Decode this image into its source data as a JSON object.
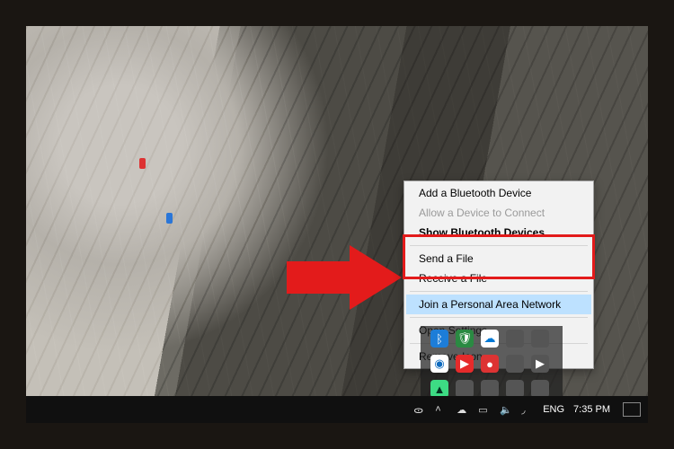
{
  "menu": {
    "add": "Add a Bluetooth Device",
    "allow": "Allow a Device to Connect",
    "show": "Show Bluetooth Devices",
    "send": "Send a File",
    "receive": "Receive a File",
    "pan": "Join a Personal Area Network",
    "settings": "Open Settings",
    "remove": "Remove Icon"
  },
  "tray": {
    "icons": [
      "bluetooth",
      "defender",
      "onedrive",
      "unknown",
      "unknown",
      "teamviewer",
      "youtube",
      "red",
      "unknown",
      "play",
      "android",
      "unknown",
      "gray",
      "gray",
      "gray"
    ]
  },
  "taskbar": {
    "people": "ᯣ",
    "lang": "ENG",
    "time": "7:35 PM"
  },
  "colors": {
    "highlight_red": "#e31b1b",
    "menu_hover": "#bde1ff"
  }
}
